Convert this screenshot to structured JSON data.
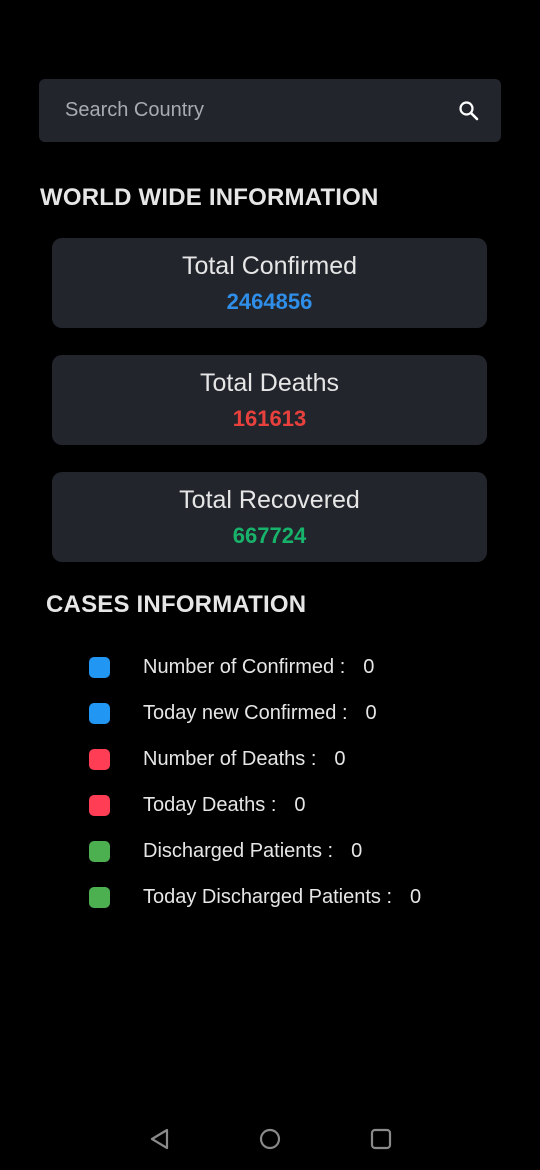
{
  "search": {
    "placeholder": "Search Country",
    "value": "",
    "icon": "search-icon"
  },
  "world_wide": {
    "title": "WORLD WIDE INFORMATION",
    "cards": [
      {
        "label": "Total Confirmed",
        "value": "2464856",
        "color": "#2f8ee8"
      },
      {
        "label": "Total Deaths",
        "value": "161613",
        "color": "#e8413d"
      },
      {
        "label": "Total Recovered",
        "value": "667724",
        "color": "#18b36b"
      }
    ]
  },
  "cases": {
    "title": "CASES INFORMATION",
    "items": [
      {
        "label": "Number of Confirmed :",
        "value": "0",
        "color": "#2196f3"
      },
      {
        "label": "Today new Confirmed :",
        "value": "0",
        "color": "#2196f3"
      },
      {
        "label": "Number of Deaths :",
        "value": "0",
        "color": "#ff3d55"
      },
      {
        "label": "Today Deaths :",
        "value": "0",
        "color": "#ff3d55"
      },
      {
        "label": "Discharged Patients :",
        "value": "0",
        "color": "#4caf50"
      },
      {
        "label": "Today Discharged Patients :",
        "value": "0",
        "color": "#4caf50"
      }
    ]
  },
  "navigation": {
    "icons": [
      "back-icon",
      "home-icon",
      "recents-icon"
    ],
    "icon_color": "#8a8a8a"
  }
}
